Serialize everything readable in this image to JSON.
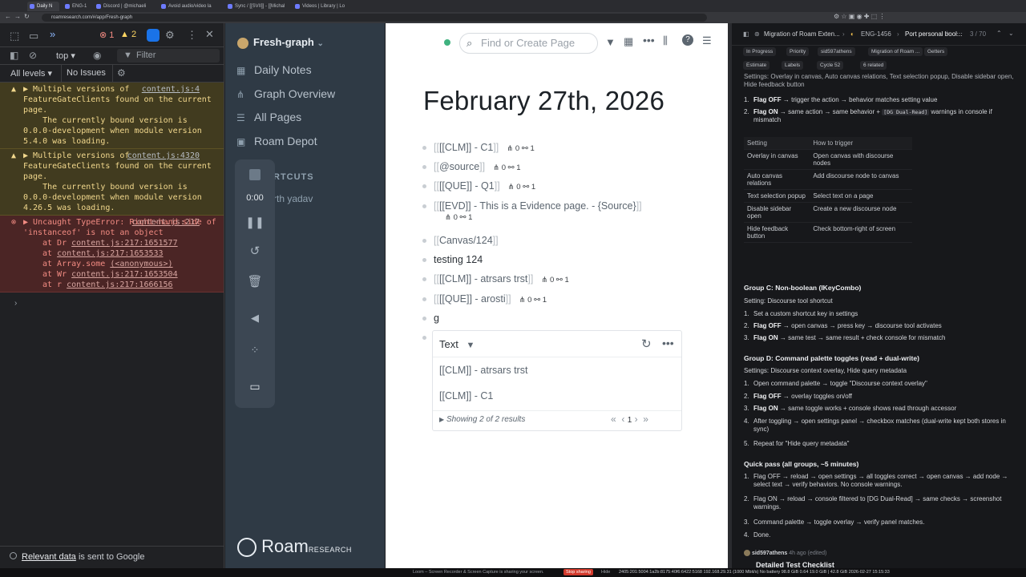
{
  "browser": {
    "tabs": [
      {
        "label": "Daily N",
        "active": true
      },
      {
        "label": "ENG-1",
        "active": false
      },
      {
        "label": "Discord | @michaeli",
        "active": false
      },
      {
        "label": "Avoid audio/video la",
        "active": false
      },
      {
        "label": "Sync / [[SVII]] - [[Michal",
        "active": false
      },
      {
        "label": "Videos | Library | Lo",
        "active": false
      }
    ],
    "url": "roamresearch.com/#/app/Fresh-graph"
  },
  "devtools": {
    "error_count": "1",
    "warn_count": "2",
    "context": "top",
    "filter_placeholder": "Filter",
    "levels": "All levels",
    "issues": "No Issues",
    "messages": [
      {
        "type": "warn",
        "source": "content.js:4",
        "text": "Multiple versions of FeatureGateClients found on the current page.\n    The currently bound version is 0.0.0-development when module version 5.4.0 was loading."
      },
      {
        "type": "warn",
        "source": "content.js:4320",
        "text": "Multiple versions of FeatureGateClients found on the current page.\n    The currently bound version is 0.0.0-development when module version 4.26.5 was loading."
      },
      {
        "type": "error",
        "source": "content.js:217",
        "text": "Uncaught TypeError: Right-hand side of 'instanceof' is not an object"
      }
    ],
    "stack": [
      {
        "fn": "at Dr",
        "loc": "content.js:217:1651577"
      },
      {
        "fn": "at",
        "loc": "content.js:217:1653533"
      },
      {
        "fn": "at Array.some",
        "loc": "(<anonymous>)"
      },
      {
        "fn": "at Wr",
        "loc": "content.js:217:1653504"
      },
      {
        "fn": "at r",
        "loc": "content.js:217:1666156"
      }
    ],
    "footer_link": "Relevant data",
    "footer_text": " is sent to Google"
  },
  "roam_sidebar": {
    "graph_name": "Fresh-graph",
    "nav": [
      "Daily Notes",
      "Graph Overview",
      "All Pages",
      "Roam Depot"
    ],
    "shortcuts_label": "RTCUTS",
    "shortcut_item": "rth yadav",
    "loom_time": "0:00",
    "brand": "Roam",
    "brand_suffix": "RESEARCH"
  },
  "main": {
    "search_placeholder": "Find or Create Page",
    "page_title": "February 27th, 2026",
    "blocks": [
      {
        "text": "[[CLM]] - C1",
        "refs": "0",
        "links": "1",
        "kind": "ref"
      },
      {
        "text": "@source",
        "refs": "0",
        "links": "1",
        "kind": "ref"
      },
      {
        "text": "[[QUE]] - Q1",
        "refs": "0",
        "links": "1",
        "kind": "ref"
      },
      {
        "text": "[[EVD]] - This is a Evidence page. - {Source}",
        "refs": "0",
        "links": "1",
        "kind": "ref"
      },
      {
        "text": "Canvas/124",
        "kind": "ref"
      },
      {
        "text": "testing 124",
        "kind": "plain"
      },
      {
        "text": "[[CLM]] - atrsars trst",
        "refs": "0",
        "links": "1",
        "kind": "ref"
      },
      {
        "text": "[[QUE]] - arosti",
        "refs": "0",
        "links": "1",
        "kind": "ref"
      },
      {
        "text": "g",
        "kind": "plain"
      }
    ],
    "query": {
      "column": "Text",
      "results": [
        "[[CLM]] - atrsars trst",
        "[[CLM]] - C1"
      ],
      "summary": "Showing 2 of 2 results",
      "page": "1"
    }
  },
  "linear": {
    "breadcrumb": "Migration of Roam Exten...",
    "issue_id": "ENG-1456",
    "issue_title": "Port personal bool...",
    "counter": "3 / 70",
    "chips": [
      "In Progress",
      "Priority",
      "sid597athens",
      "Migration of Roam ...",
      "Getters"
    ],
    "chips2": [
      "Estimate",
      "Labels",
      "Cycle 52",
      "6 related"
    ],
    "settings_line": "Settings: Overlay in canvas, Auto canvas relations, Text selection popup, Disable sidebar open, Hide feedback button",
    "flag_lines": [
      {
        "num": "1.",
        "bold": "Flag OFF",
        "text": " → trigger the action → behavior matches setting value"
      },
      {
        "num": "2.",
        "bold": "Flag ON",
        "text": " → same action → same behavior + ",
        "code": "[DG Dual-Read]",
        "tail": " warnings in console if mismatch"
      }
    ],
    "table_head": [
      "Setting",
      "How to trigger"
    ],
    "table_rows": [
      [
        "Overlay in canvas",
        "Open canvas with discourse nodes"
      ],
      [
        "Auto canvas relations",
        "Add discourse node to canvas"
      ],
      [
        "Text selection popup",
        "Select text on a page"
      ],
      [
        "Disable sidebar open",
        "Create a new discourse node"
      ],
      [
        "Hide feedback button",
        "Check bottom-right of screen"
      ]
    ],
    "group_c": {
      "title": "Group C: Non-boolean (IKeyCombo)",
      "setting": "Setting: Discourse tool shortcut",
      "items": [
        {
          "num": "1.",
          "bold": "",
          "text": "Set a custom shortcut key in settings"
        },
        {
          "num": "2.",
          "bold": "Flag OFF",
          "text": " → open canvas → press key → discourse tool activates"
        },
        {
          "num": "3.",
          "bold": "Flag ON",
          "text": " → same test → same result + check console for mismatch"
        }
      ]
    },
    "group_d": {
      "title": "Group D: Command palette toggles (read + dual-write)",
      "setting": "Settings: Discourse context overlay, Hide query metadata",
      "items": [
        {
          "num": "1.",
          "bold": "",
          "text": "Open command palette → toggle \"Discourse context overlay\""
        },
        {
          "num": "2.",
          "bold": "Flag OFF",
          "text": " → overlay toggles on/off"
        },
        {
          "num": "3.",
          "bold": "Flag ON",
          "text": " → same toggle works + console shows read through accessor"
        },
        {
          "num": "4.",
          "bold": "",
          "text": "After toggling → open settings panel → checkbox matches (dual-write kept both stores in sync)"
        },
        {
          "num": "5.",
          "bold": "",
          "text": "Repeat for \"Hide query metadata\""
        }
      ]
    },
    "quick": {
      "title": "Quick pass (all groups, ~5 minutes)",
      "items": [
        {
          "num": "1.",
          "text": "Flag OFF → reload → open settings → all toggles correct → open canvas → add node → select text → verify behaviors. No console warnings."
        },
        {
          "num": "2.",
          "text": "Flag ON → reload → console filtered to [DG Dual-Read] → same checks → screenshot warnings."
        },
        {
          "num": "3.",
          "text": "Command palette → toggle overlay → verify panel matches."
        },
        {
          "num": "4.",
          "text": "Done."
        }
      ]
    },
    "comment_author": "sid597athens",
    "comment_time": "4h ago (edited)",
    "comment_heading": "Detailed Test Checklist"
  },
  "taskbar": {
    "loom_text": "Loom – Screen Recorder & Screen Capture is sharing your screen.",
    "stop_label": "Stop sharing",
    "hide_label": "Hide",
    "status": "2405:201:5004:1a2b:8175:40f6:6422:5168  192.168.29.31 (1000 Mbit/s)  No battery 98.8 GiB 0.64 19.0 GiB | 42.8 GiB 2026-02-27 15:15:33"
  }
}
